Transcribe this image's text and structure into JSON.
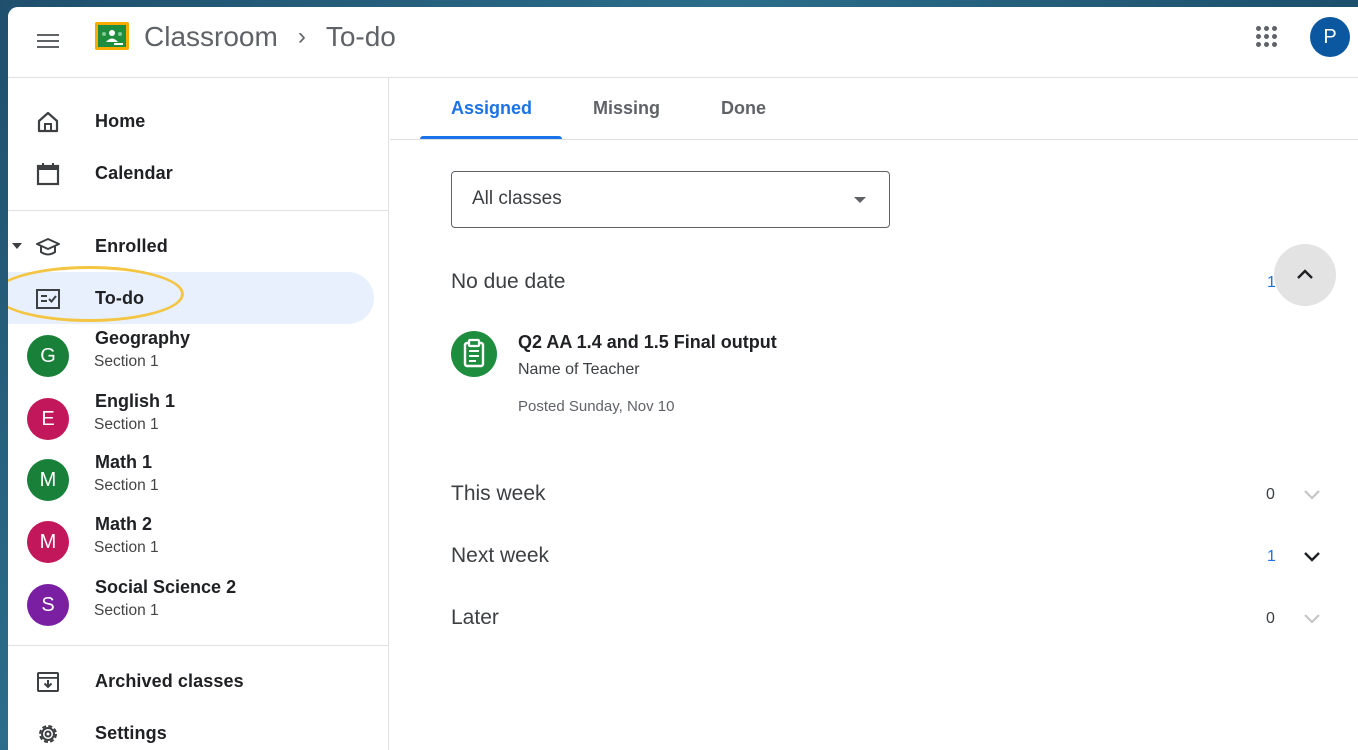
{
  "header": {
    "app_name": "Classroom",
    "separator": "›",
    "current_page": "To-do",
    "avatar_letter": "P"
  },
  "sidebar": {
    "home": "Home",
    "calendar": "Calendar",
    "enrolled": "Enrolled",
    "todo": "To-do",
    "classes": [
      {
        "initial": "G",
        "name": "Geography",
        "section": "Section 1",
        "color": "#188038"
      },
      {
        "initial": "E",
        "name": "English 1",
        "section": "Section 1",
        "color": "#c2185b"
      },
      {
        "initial": "M",
        "name": "Math 1",
        "section": "Section 1",
        "color": "#188038"
      },
      {
        "initial": "M",
        "name": "Math 2",
        "section": "Section 1",
        "color": "#c2185b"
      },
      {
        "initial": "S",
        "name": "Social Science 2",
        "section": "Section 1",
        "color": "#7b1fa2"
      }
    ],
    "archived": "Archived classes",
    "settings": "Settings"
  },
  "tabs": {
    "assigned": "Assigned",
    "missing": "Missing",
    "done": "Done"
  },
  "filter": {
    "selected": "All classes"
  },
  "sections": {
    "no_due_date": {
      "label": "No due date",
      "count": "1"
    },
    "this_week": {
      "label": "This week",
      "count": "0"
    },
    "next_week": {
      "label": "Next week",
      "count": "1"
    },
    "later": {
      "label": "Later",
      "count": "0"
    }
  },
  "assignment": {
    "title": "Q2 AA 1.4 and 1.5 Final output",
    "teacher": "Name of Teacher",
    "posted": "Posted Sunday, Nov 10"
  },
  "colors": {
    "accent": "#1a73e8",
    "active_nav_bg": "#e8f0fe",
    "highlight_ring": "#f4c542",
    "assignment_icon": "#1e8e3e"
  }
}
